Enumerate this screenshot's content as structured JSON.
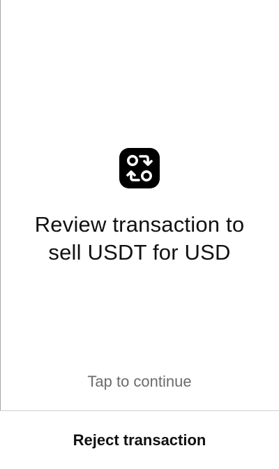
{
  "icon": {
    "name": "swap-icon",
    "background": "#000000",
    "foreground": "#ffffff"
  },
  "review": {
    "title_line1": "Review transaction to",
    "title_line2": "sell USDT for USD"
  },
  "hint": {
    "label": "Tap to continue",
    "color": "#6b6b6b"
  },
  "footer": {
    "reject_label": "Reject transaction"
  }
}
